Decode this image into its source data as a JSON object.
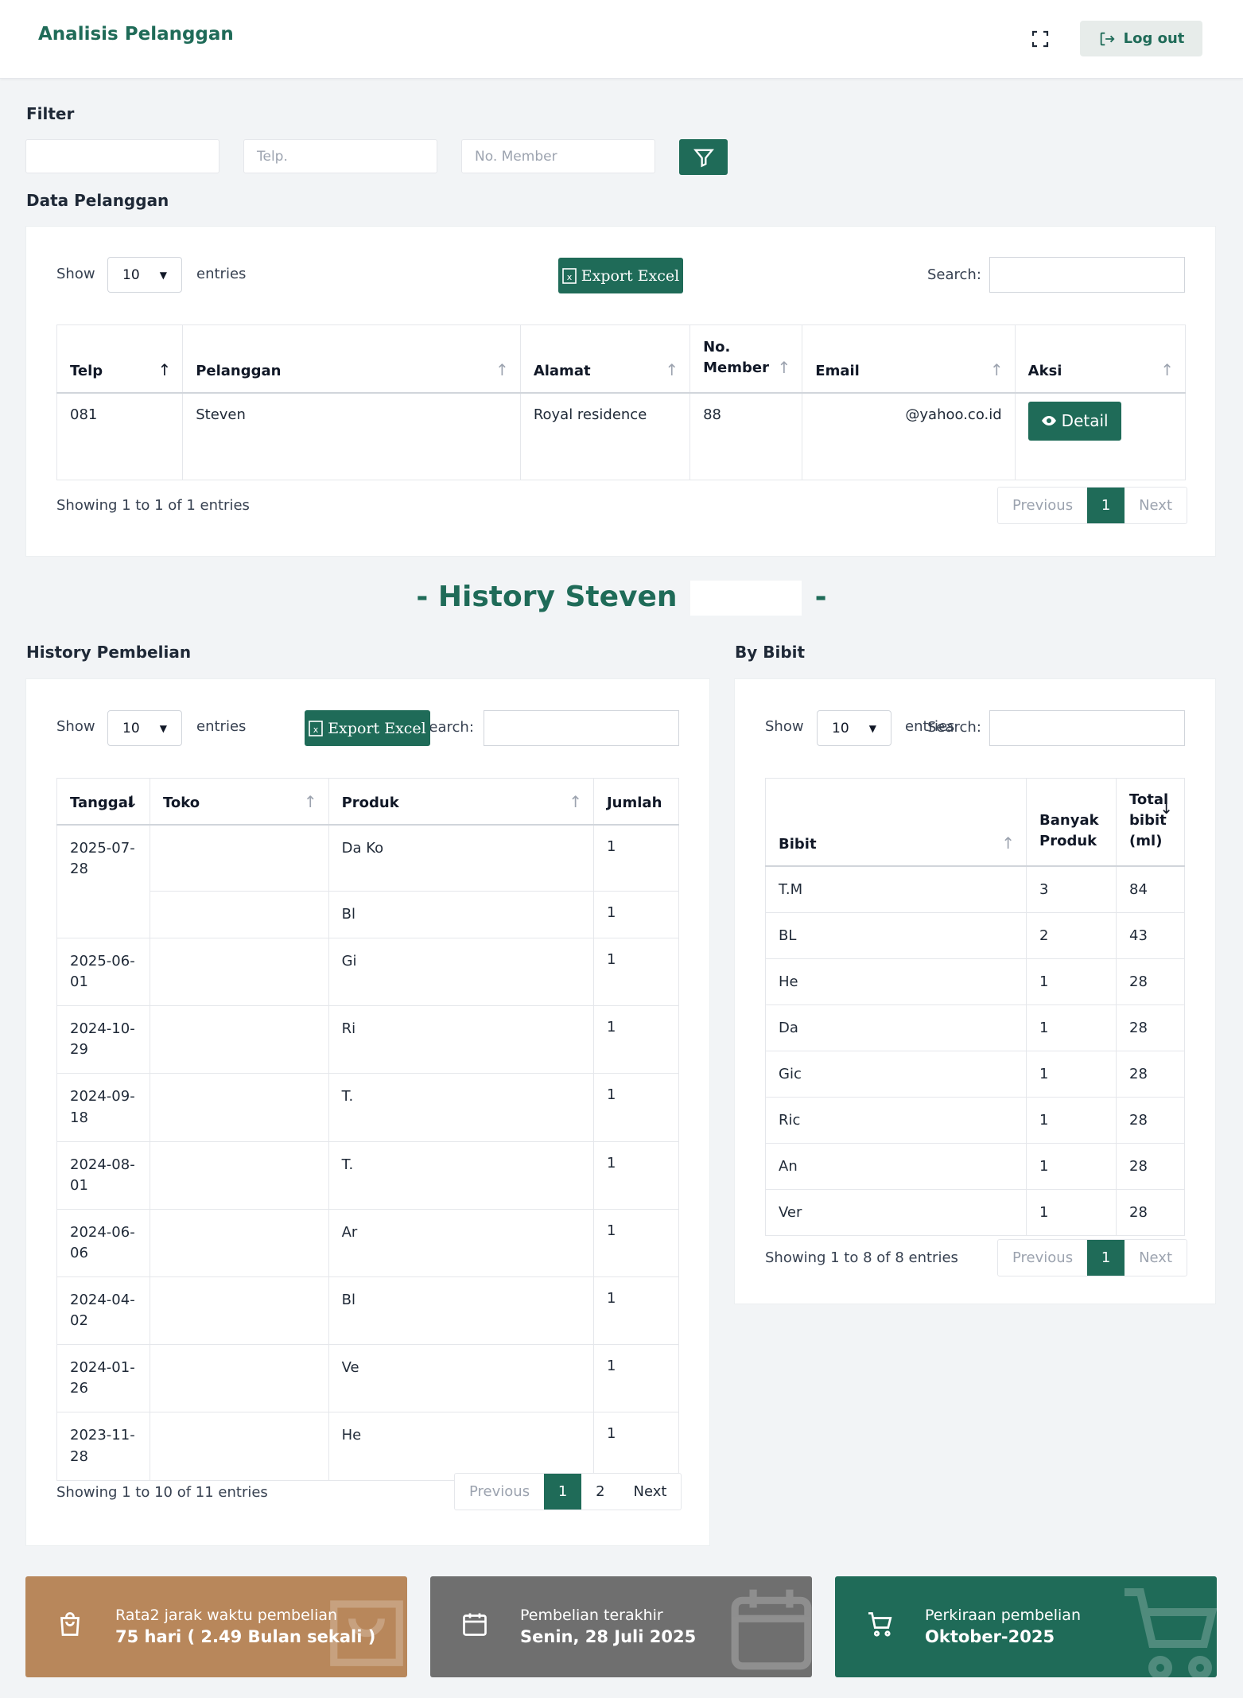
{
  "header": {
    "title": "Analisis Pelanggan",
    "logout_label": "Log out"
  },
  "filter": {
    "title": "Filter",
    "name_placeholder": "",
    "telp_placeholder": "Telp.",
    "member_placeholder": "No. Member"
  },
  "data_pelanggan": {
    "title": "Data Pelanggan",
    "show_label": "Show",
    "entries_label": "entries",
    "page_length": "10",
    "export_label": "Export Excel",
    "search_label": "Search:",
    "columns": [
      "Telp",
      "Pelanggan",
      "Alamat",
      "No. Member",
      "Email",
      "Aksi"
    ],
    "rows": [
      {
        "telp": "081",
        "pelanggan": "Steven",
        "alamat": "Royal residence",
        "member": "88",
        "email": "@yahoo.co.id",
        "aksi": "Detail"
      }
    ],
    "info": "Showing 1 to 1 of 1 entries",
    "prev": "Previous",
    "page": "1",
    "next": "Next"
  },
  "history": {
    "title_prefix": "- History Steven",
    "title_suffix": "-"
  },
  "history_pembelian": {
    "title": "History Pembelian",
    "show_label": "Show",
    "entries_label": "entries",
    "page_length": "10",
    "export_label": "Export Excel",
    "search_label": "Search:",
    "columns": [
      "Tanggal",
      "Toko",
      "Produk",
      "Jumlah"
    ],
    "rows": [
      {
        "tanggal": "2025-07-28",
        "produk": "Da Ko",
        "jumlah": "1"
      },
      {
        "tanggal": "",
        "produk": "Bl",
        "jumlah": "1"
      },
      {
        "tanggal": "2025-06-01",
        "produk": "Gi",
        "jumlah": "1"
      },
      {
        "tanggal": "2024-10-29",
        "produk": "Ri",
        "jumlah": "1"
      },
      {
        "tanggal": "2024-09-18",
        "produk": "T.",
        "jumlah": "1"
      },
      {
        "tanggal": "2024-08-01",
        "produk": "T.",
        "jumlah": "1"
      },
      {
        "tanggal": "2024-06-06",
        "produk": "Ar",
        "jumlah": "1"
      },
      {
        "tanggal": "2024-04-02",
        "produk": "Bl",
        "jumlah": "1"
      },
      {
        "tanggal": "2024-01-26",
        "produk": "Ve",
        "jumlah": "1"
      },
      {
        "tanggal": "2023-11-28",
        "produk": "He",
        "jumlah": "1"
      }
    ],
    "info": "Showing 1 to 10 of 11 entries",
    "prev": "Previous",
    "page1": "1",
    "page2": "2",
    "next": "Next"
  },
  "by_bibit": {
    "title": "By Bibit",
    "show_label": "Show",
    "entries_label": "entries",
    "page_length": "10",
    "search_label": "Search:",
    "columns": [
      "Bibit",
      "Banyak Produk",
      "Total bibit (ml)"
    ],
    "rows": [
      {
        "bibit": "T.M",
        "banyak": "3",
        "total": "84"
      },
      {
        "bibit": "BL",
        "banyak": "2",
        "total": "43"
      },
      {
        "bibit": "He",
        "banyak": "1",
        "total": "28"
      },
      {
        "bibit": "Da",
        "banyak": "1",
        "total": "28"
      },
      {
        "bibit": "Gic",
        "banyak": "1",
        "total": "28"
      },
      {
        "bibit": "Ric",
        "banyak": "1",
        "total": "28"
      },
      {
        "bibit": "An",
        "banyak": "1",
        "total": "28"
      },
      {
        "bibit": "Ver",
        "banyak": "1",
        "total": "28"
      }
    ],
    "info": "Showing 1 to 8 of 8 entries",
    "prev": "Previous",
    "page": "1",
    "next": "Next"
  },
  "stats": [
    {
      "label": "Rata2 jarak waktu pembelian",
      "value": "75 hari ( 2.49 Bulan sekali )",
      "color": "#b8875b",
      "icon": "shopping-bag-icon"
    },
    {
      "label": "Pembelian terakhir",
      "value": "Senin, 28 Juli 2025",
      "color": "#6f6f6f",
      "icon": "calendar-icon"
    },
    {
      "label": "Perkiraan pembelian",
      "value": "Oktober-2025",
      "color": "#1f6b58",
      "icon": "cart-icon"
    }
  ],
  "colors": {
    "primary": "#1f6b58",
    "background": "#f2f4f6"
  }
}
